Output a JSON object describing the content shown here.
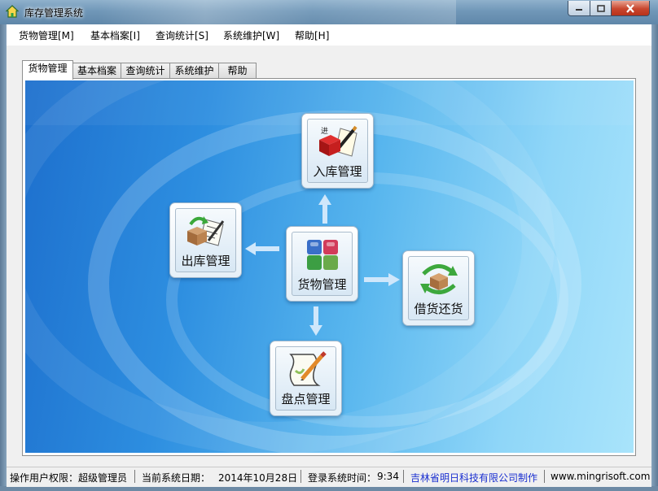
{
  "window": {
    "title": "库存管理系统",
    "controls": {
      "minimize": "minimize-icon",
      "maximize": "maximize-icon",
      "close": "close-icon"
    }
  },
  "menu": {
    "items": [
      "货物管理[M]",
      "基本档案[I]",
      "查询统计[S]",
      "系统维护[W]",
      "帮助[H]"
    ]
  },
  "tabs": {
    "items": [
      "货物管理",
      "基本档案",
      "查询统计",
      "系统维护",
      "帮助"
    ],
    "active": "货物管理"
  },
  "modules": {
    "stock_in": {
      "label": "入库管理",
      "icon": "stock-in-icon"
    },
    "stock_out": {
      "label": "出库管理",
      "icon": "stock-out-icon"
    },
    "goods": {
      "label": "货物管理",
      "icon": "goods-cubes-icon"
    },
    "borrow_return": {
      "label": "借货还货",
      "icon": "borrow-return-icon"
    },
    "inventory": {
      "label": "盘点管理",
      "icon": "inventory-check-icon"
    }
  },
  "status": {
    "user_permission_label": "操作用户权限：",
    "user_permission_value": "超级管理员",
    "date_label": "当前系统日期：",
    "date_value": "2014年10月28日",
    "login_time_label": "登录系统时间：",
    "login_time_value": "9:34",
    "company": "吉林省明日科技有限公司制作",
    "website": "www.mingrisoft.com"
  },
  "colors": {
    "accent_link": "#1a2fd0",
    "canvas_dark": "#1d6fcd",
    "canvas_light": "#a9e4fb"
  }
}
